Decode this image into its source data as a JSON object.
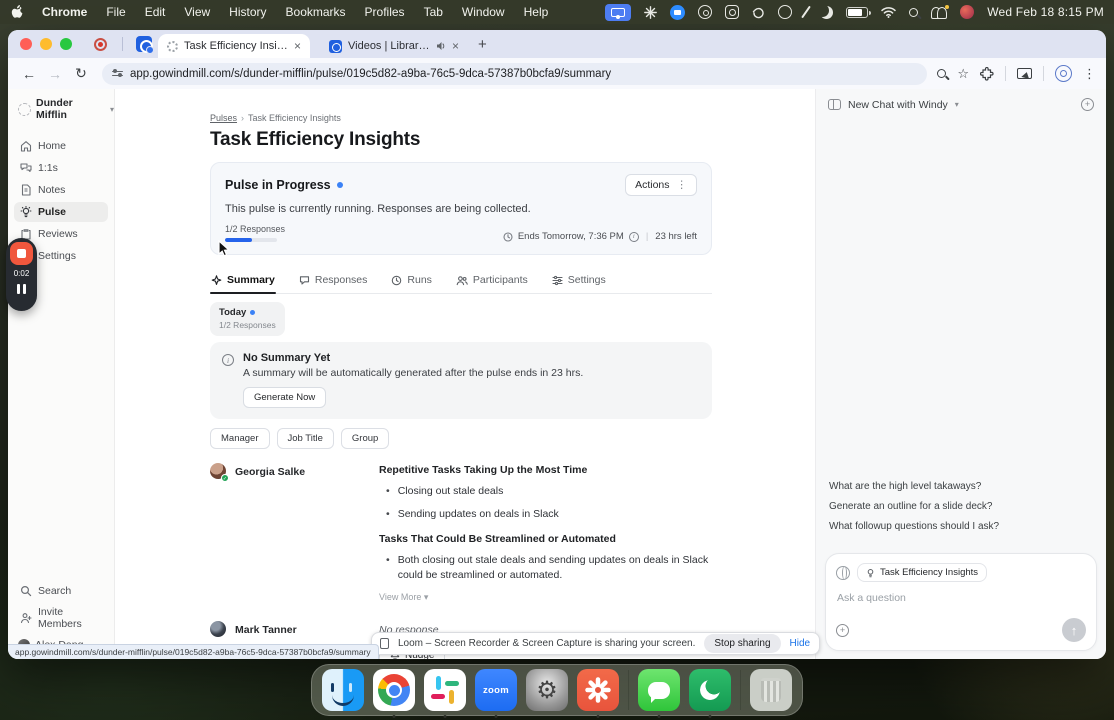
{
  "colors": {
    "accent": "#3b82f6",
    "progress": "#2563eb",
    "link": "#1a73e8",
    "loom_orange": "#f0573d"
  },
  "menu_bar": {
    "app": "Chrome",
    "items": [
      "File",
      "Edit",
      "View",
      "History",
      "Bookmarks",
      "Profiles",
      "Tab",
      "Window",
      "Help"
    ],
    "clock": "Wed Feb 18  8:15 PM"
  },
  "browser": {
    "active_tab": "Task Efficiency Insights",
    "second_tab": "Videos | Library | Loom",
    "close_glyph": "×",
    "new_tab_glyph": "+",
    "url": "app.gowindmill.com/s/dunder-mifflin/pulse/019c5d82-a9ba-76c5-9dca-57387b0bcfa9/summary"
  },
  "sidebar": {
    "workspace": "Dunder Mifflin",
    "items": [
      {
        "label": "Home"
      },
      {
        "label": "1:1s"
      },
      {
        "label": "Notes"
      },
      {
        "label": "Pulse"
      },
      {
        "label": "Reviews"
      },
      {
        "label": "Settings"
      }
    ],
    "search": "Search",
    "invite": "Invite Members",
    "user": "Alex Dang"
  },
  "recorder": {
    "time": "0:02"
  },
  "pulse": {
    "breadcrumb": {
      "root": "Pulses",
      "separator": "›",
      "current": "Task Efficiency Insights"
    },
    "title": "Task Efficiency Insights",
    "status": {
      "title": "Pulse in Progress",
      "actions_label": "Actions",
      "kebab_glyph": "⋮",
      "description": "This pulse is currently running. Responses are being collected.",
      "responses_label": "1/2 Responses",
      "progress_percent": 52,
      "ends": "Ends Tomorrow, 7:36 PM",
      "divider_glyph": "|",
      "time_left": "23 hrs left"
    },
    "tabs": [
      {
        "label": "Summary"
      },
      {
        "label": "Responses"
      },
      {
        "label": "Runs"
      },
      {
        "label": "Participants"
      },
      {
        "label": "Settings"
      }
    ],
    "today_chip": {
      "label": "Today",
      "sub": "1/2 Responses"
    },
    "summary_banner": {
      "title": "No Summary Yet",
      "description": "A summary will be automatically generated after the pulse ends in 23 hrs.",
      "button": "Generate Now"
    },
    "filters": [
      {
        "label": "Manager"
      },
      {
        "label": "Job Title"
      },
      {
        "label": "Group"
      }
    ],
    "responses": [
      {
        "name": "Georgia Salke",
        "sections": [
          {
            "heading": "Repetitive Tasks Taking Up the Most Time",
            "bullets": [
              "Closing out stale deals",
              "Sending updates on deals in Slack"
            ]
          },
          {
            "heading": "Tasks That Could Be Streamlined or Automated",
            "bullets": [
              "Both closing out stale deals and sending updates on deals in Slack could be streamlined or automated."
            ]
          }
        ],
        "view_more": "View More  ▾"
      },
      {
        "name": "Mark Tanner",
        "status": "No response",
        "action": "Nudge"
      }
    ]
  },
  "chat_panel": {
    "title": "New Chat with Windy",
    "suggestions": [
      "What are the high level takaways?",
      "Generate an outline for a slide deck?",
      "What followup questions should I ask?"
    ],
    "context_chip": "Task Efficiency Insights",
    "input_placeholder": "Ask a question",
    "send_glyph": "↑",
    "add_glyph": "+"
  },
  "share_bar": {
    "message": "Loom – Screen Recorder & Screen Capture is sharing your screen.",
    "stop_button": "Stop sharing",
    "hide_link": "Hide"
  },
  "status_bar_url": "app.gowindmill.com/s/dunder-mifflin/pulse/019c5d82-a9ba-76c5-9dca-57387b0bcfa9/summary",
  "dock": {
    "apps": [
      "finder",
      "chrome",
      "slack",
      "zoom",
      "system-settings",
      "loom",
      "messages",
      "windy",
      "trash"
    ],
    "zoom_label": "zoom",
    "settings_glyph": "⚙"
  }
}
